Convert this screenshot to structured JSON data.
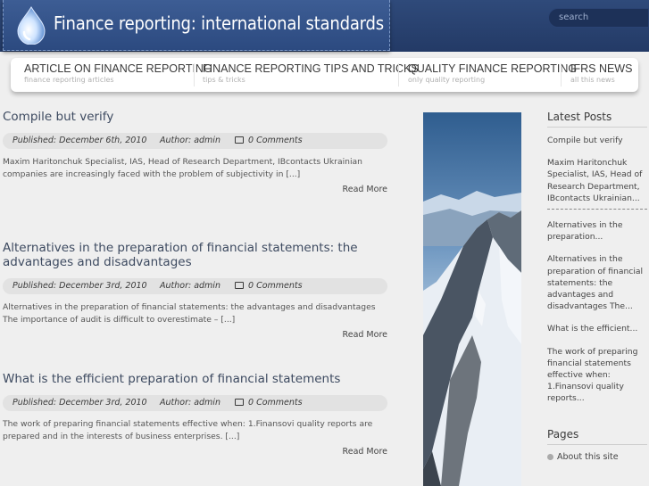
{
  "header": {
    "title": "Finance reporting: international standards",
    "search_placeholder": "search"
  },
  "nav": [
    {
      "label": "Article on finance reporting",
      "sub": "finance reporting articles"
    },
    {
      "label": "Finance reporting tips and tricks",
      "sub": "tips & tricks"
    },
    {
      "label": "Quality finance reporting",
      "sub": "only quality reporting"
    },
    {
      "label": "IFRS news",
      "sub": "all this news"
    }
  ],
  "posts": [
    {
      "title": "Compile but verify",
      "published": "Published: December 6th, 2010",
      "author": "Author: admin",
      "comments": "0 Comments",
      "excerpt": "Maxim Haritonchuk Specialist, IAS, Head of Research Department, IBcontacts Ukrainian companies are increasingly faced with the problem of subjectivity in [...]",
      "read_more": "Read More"
    },
    {
      "title": "Alternatives in the preparation of financial statements: the advantages and disadvantages",
      "published": "Published: December 3rd, 2010",
      "author": "Author: admin",
      "comments": "0 Comments",
      "excerpt": "Alternatives in the preparation of financial statements: the advantages and disadvantages The importance of audit is difficult to overestimate – [...]",
      "read_more": "Read More"
    },
    {
      "title": "What is the efficient preparation of financial statements",
      "published": "Published: December 3rd, 2010",
      "author": "Author: admin",
      "comments": "0 Comments",
      "excerpt": "The work of preparing financial statements effective when: 1.Finansovi quality reports are prepared and in the interests of business enterprises. [...]",
      "read_more": "Read More"
    }
  ],
  "sidebar": {
    "latest_heading": "Latest Posts",
    "latest": [
      "Compile but verify",
      "Maxim Haritonchuk Specialist, IAS, Head of Research Department, IBcontacts Ukrainian...",
      "Alternatives in the preparation...",
      "Alternatives in the preparation of financial statements: the advantages and disadvantages The...",
      "What is the efficient...",
      "The work of preparing financial statements effective when: 1.Finansovi quality reports..."
    ],
    "pages_heading": "Pages",
    "pages": [
      "About this site"
    ]
  }
}
